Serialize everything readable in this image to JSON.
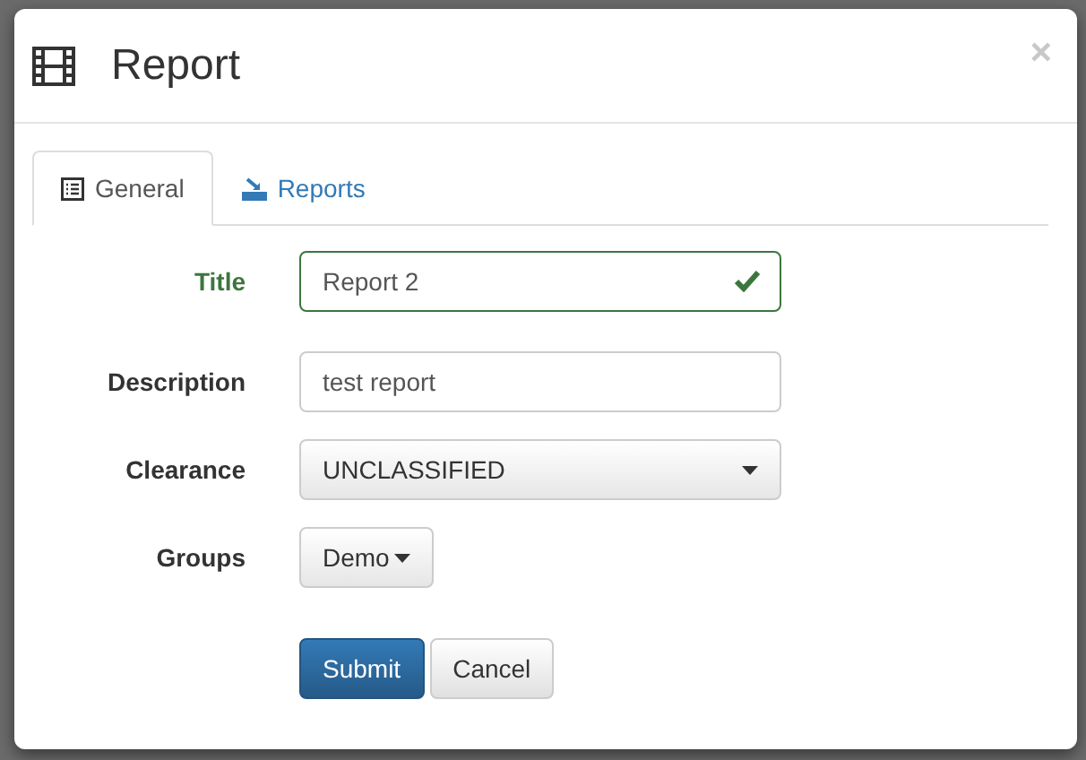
{
  "dialog": {
    "title": "Report",
    "close": "×"
  },
  "tabs": [
    {
      "label": "General",
      "selected": true
    },
    {
      "label": "Reports",
      "selected": false
    }
  ],
  "form": {
    "fields": [
      {
        "kind": "text",
        "label": "Title",
        "value": "Report 2",
        "valid": true
      },
      {
        "kind": "text",
        "label": "Description",
        "value": "test report",
        "valid": false
      },
      {
        "kind": "select",
        "label": "Clearance",
        "value": "UNCLASSIFIED"
      },
      {
        "kind": "dropdown-button",
        "label": "Groups",
        "value": "Demo"
      }
    ]
  },
  "buttons": [
    {
      "label": "Submit",
      "kind": "primary"
    },
    {
      "label": "Cancel",
      "kind": "default"
    }
  ]
}
